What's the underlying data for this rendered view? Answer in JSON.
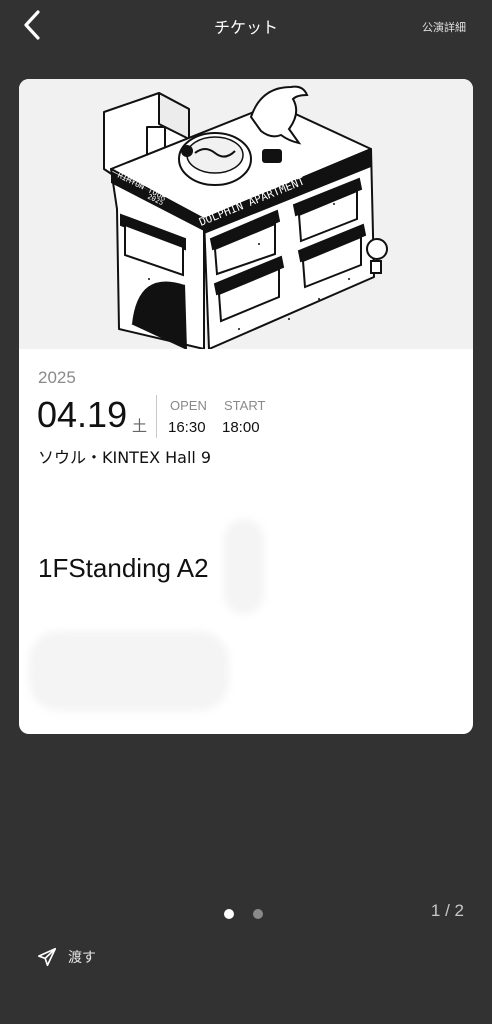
{
  "header": {
    "title": "チケット",
    "detail_link": "公演詳細",
    "back_icon": "chevron-left-icon"
  },
  "ticket": {
    "artwork": {
      "roof_text_left": "RIMYUN TOUR",
      "roof_text_year": "2025",
      "sign_text": "DOLPHIN APARTMENT"
    },
    "year": "2025",
    "date": "04.19",
    "weekday": "土",
    "open_label": "OPEN",
    "open_time": "16:30",
    "start_label": "START",
    "start_time": "18:00",
    "venue": "ソウル・KINTEX Hall 9",
    "seat": "1FStanding A2"
  },
  "pagination": {
    "dots": [
      {
        "active": true
      },
      {
        "active": false
      }
    ],
    "counter": "1 / 2"
  },
  "footer": {
    "transfer_label": "渡す",
    "transfer_icon": "send-icon"
  },
  "colors": {
    "background": "#323232",
    "card": "#ffffff",
    "artwork_bg": "#f1f1f1",
    "muted_text": "#8a8a8a"
  }
}
